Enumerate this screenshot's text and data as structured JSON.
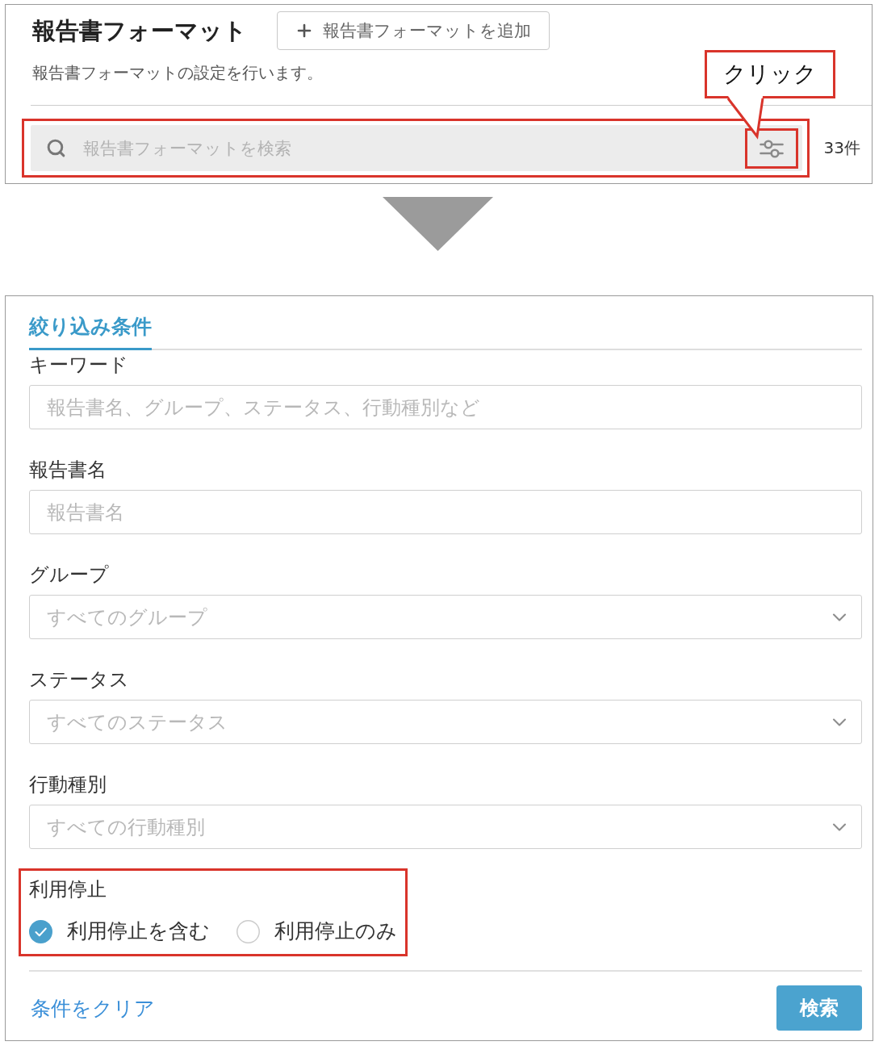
{
  "header": {
    "title": "報告書フォーマット",
    "add_button": {
      "label": "報告書フォーマットを追加"
    },
    "description": "報告書フォーマットの設定を行います。",
    "search": {
      "placeholder": "報告書フォーマットを検索",
      "highlighted": true,
      "filter_button": {
        "highlighted": true
      }
    },
    "count": "33件"
  },
  "callout": {
    "text": "クリック"
  },
  "filter_panel": {
    "tabs": [
      {
        "label": "絞り込み条件",
        "selected": true
      }
    ],
    "fields": [
      {
        "kind": "text",
        "label": "キーワード",
        "placeholder": "報告書名、グループ、ステータス、行動種別など"
      },
      {
        "kind": "text",
        "label": "報告書名",
        "placeholder": "報告書名"
      },
      {
        "kind": "select",
        "label": "グループ",
        "placeholder": "すべてのグループ"
      },
      {
        "kind": "select",
        "label": "ステータス",
        "placeholder": "すべてのステータス"
      },
      {
        "kind": "select",
        "label": "行動種別",
        "placeholder": "すべての行動種別"
      }
    ],
    "suspension": {
      "label": "利用停止",
      "highlighted": true,
      "options": [
        {
          "label": "利用停止を含む",
          "selected": true
        },
        {
          "label": "利用停止のみ",
          "selected": false
        }
      ]
    },
    "clear_link": "条件をクリア",
    "search_button": "検索"
  }
}
